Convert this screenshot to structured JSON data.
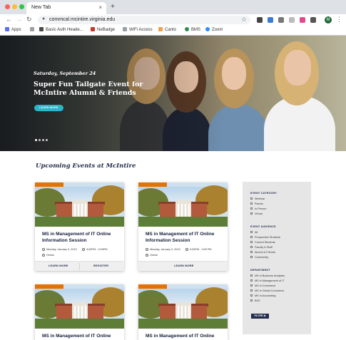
{
  "browser": {
    "tab_title": "New Tab",
    "tab_close": "×",
    "new_tab": "+",
    "url": "commcal.mcintire.virginia.edu",
    "bookmarks": [
      {
        "label": "Apps",
        "color": "#5b6ef5"
      },
      {
        "label": "",
        "color": "#9aa0a6"
      },
      {
        "label": "Basic Auth Heade...",
        "color": "#4a4a4a"
      },
      {
        "label": "NeBadge",
        "color": "#c0392b"
      },
      {
        "label": "WiFi Access",
        "color": "#9aa0a6"
      },
      {
        "label": "Canto",
        "color": "#f0a04b"
      },
      {
        "label": "BMS",
        "color": "#2e8b57"
      },
      {
        "label": "Zoom",
        "color": "#2d8cff"
      }
    ],
    "profile_initial": "M"
  },
  "hero": {
    "date": "Saturday, September 24",
    "title": "Super Fun Tailgate Event for McIntire Alumni & Friends",
    "button": "LEARN MORE",
    "slides": 4,
    "active_slide": 0
  },
  "events": {
    "heading": "Upcoming Events at McIntire",
    "cards": [
      {
        "title": "MS in Management of IT Online Information Session",
        "date": "Monday, January 3, 2019",
        "time": "3:00PM - 3:00PM",
        "location": "Online",
        "link1": "LEARN MORE",
        "link2": "REGISTER"
      },
      {
        "title": "MS in Management of IT Online Information Session",
        "date": "Monday, January 3, 2019",
        "time": "3:00PM - 3:00 PM",
        "location": "Online",
        "link1": "LEARN MORE"
      },
      {
        "title": "MS in Management of IT Online Information Session"
      },
      {
        "title": "MS in Management of IT Online Information Session"
      }
    ]
  },
  "filters": {
    "groups": [
      {
        "heading": "EVENT CATEGORY",
        "items": [
          "Webinar",
          "Panels",
          "In-Person",
          "Virtual"
        ]
      },
      {
        "heading": "EVENT AUDIENCE",
        "items": [
          "All",
          "Prospective Students",
          "Current Students",
          "Faculty & Staff",
          "Alumni & Friends",
          "Community"
        ]
      },
      {
        "heading": "DEPARTMENT",
        "items": [
          "MS in Business Analytics",
          "MS in Management of IT",
          "MS in Commerce",
          "MS in Global Commerce",
          "MS in Accounting",
          "BSC"
        ]
      }
    ],
    "button": "FILTER ⊕"
  },
  "colors": {
    "navy": "#232d4b",
    "orange": "#e57200",
    "teal": "#2bb5c9"
  }
}
